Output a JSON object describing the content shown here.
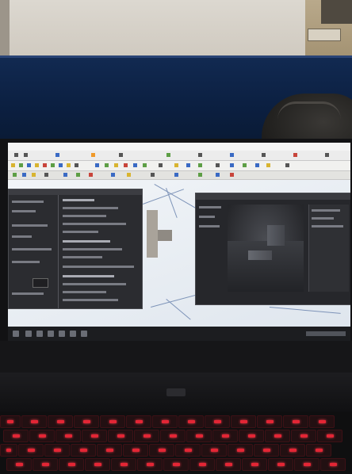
{
  "scene": {
    "type": "photo",
    "subject": "laptop-screen-with-cad-software",
    "colors": {
      "partition": "#0b1f40",
      "keyboard_backlight": "#e32635",
      "viewport": "#e9edf2",
      "panel_dark": "#2b2c30"
    }
  }
}
